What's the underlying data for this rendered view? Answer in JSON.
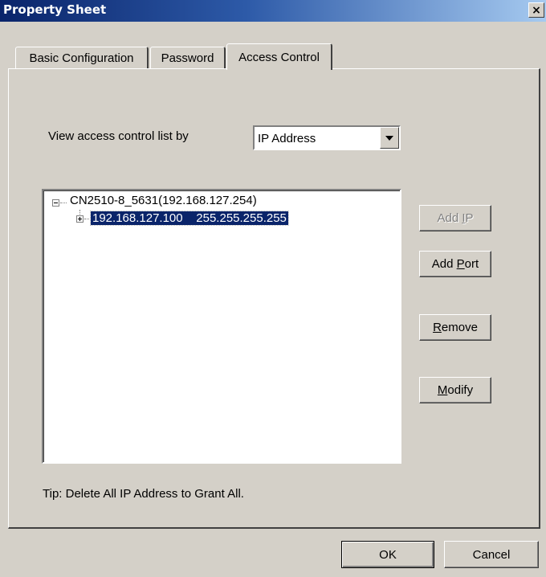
{
  "window": {
    "title": "Property Sheet",
    "close_label": "×"
  },
  "tabs": [
    {
      "label": "Basic Configuration",
      "active": false
    },
    {
      "label": "Password",
      "active": false
    },
    {
      "label": "Access Control",
      "active": true
    }
  ],
  "view_by": {
    "label": "View access control list by",
    "value": "IP Address"
  },
  "tree": {
    "root": "CN2510-8_5631(192.168.127.254)",
    "child": "192.168.127.100    255.255.255.255"
  },
  "buttons": {
    "add_ip": {
      "prefix": "Add ",
      "mnemonic": "I",
      "suffix": "P",
      "enabled": false
    },
    "add_port": {
      "prefix": "Add ",
      "mnemonic": "P",
      "suffix": "ort",
      "enabled": true
    },
    "remove": {
      "prefix": "",
      "mnemonic": "R",
      "suffix": "emove",
      "enabled": true
    },
    "modify": {
      "prefix": "",
      "mnemonic": "M",
      "suffix": "odify",
      "enabled": true
    }
  },
  "tip": "Tip: Delete All IP Address to Grant All.",
  "footer": {
    "ok": "OK",
    "cancel": "Cancel"
  }
}
